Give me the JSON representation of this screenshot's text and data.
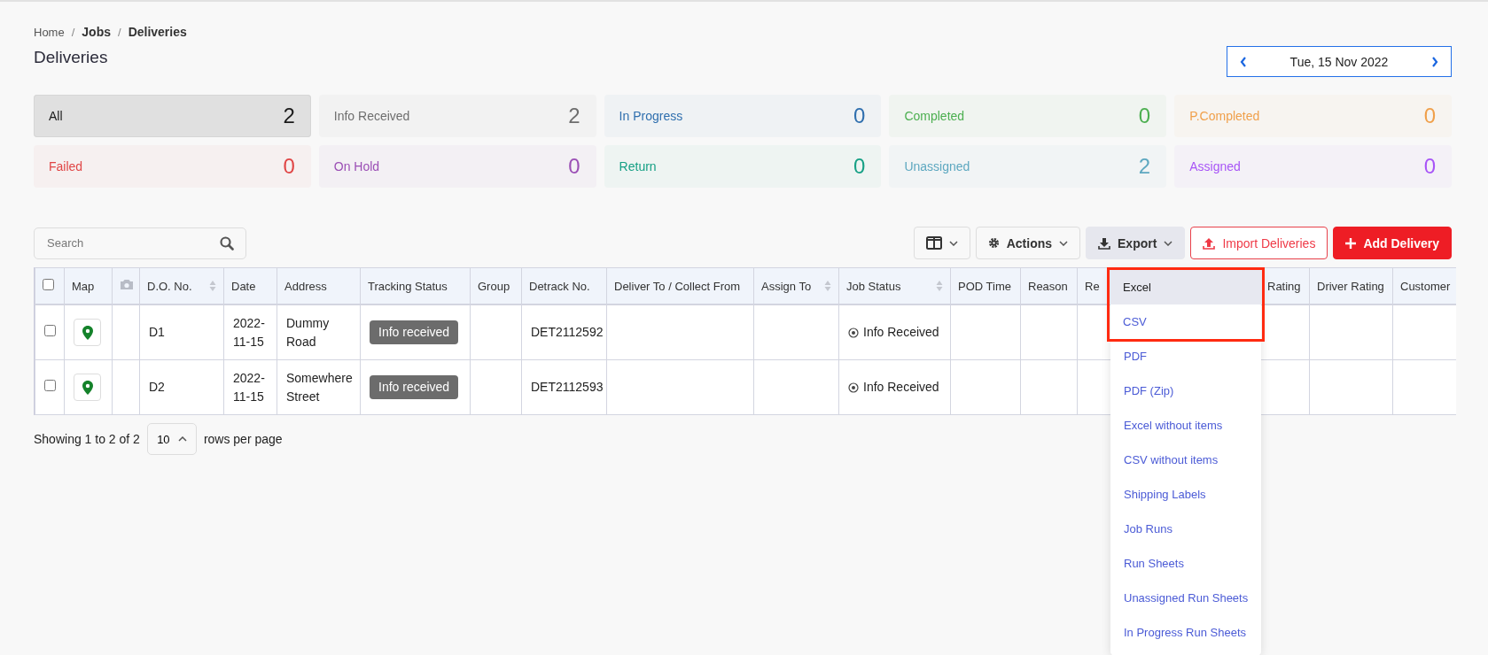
{
  "breadcrumb": {
    "separator": "/",
    "items": [
      {
        "label": "Home",
        "current": false
      },
      {
        "label": "Jobs",
        "current": true
      },
      {
        "label": "Deliveries",
        "current": true
      }
    ]
  },
  "page_title": "Deliveries",
  "date_picker": {
    "value": "Tue, 15 Nov 2022"
  },
  "status_cards": [
    {
      "label": "All",
      "count": "2",
      "color": "#1a1a1a",
      "selected": true
    },
    {
      "label": "Info Received",
      "count": "2",
      "color": "#6e6e6e",
      "selected": false
    },
    {
      "label": "In Progress",
      "count": "0",
      "color": "#2f6fae",
      "selected": false
    },
    {
      "label": "Completed",
      "count": "0",
      "color": "#4caf50",
      "selected": false
    },
    {
      "label": "P.Completed",
      "count": "0",
      "color": "#f0a04b",
      "selected": false
    },
    {
      "label": "Failed",
      "count": "0",
      "color": "#e04646",
      "selected": false
    },
    {
      "label": "On Hold",
      "count": "0",
      "color": "#9b4fb5",
      "selected": false
    },
    {
      "label": "Return",
      "count": "0",
      "color": "#16a085",
      "selected": false
    },
    {
      "label": "Unassigned",
      "count": "2",
      "color": "#5ea8c0",
      "selected": false
    },
    {
      "label": "Assigned",
      "count": "0",
      "color": "#a855f7",
      "selected": false
    }
  ],
  "search": {
    "placeholder": "Search"
  },
  "toolbar": {
    "actions_label": "Actions",
    "export": {
      "label": "Export",
      "expanded": true
    },
    "import_label": "Import Deliveries",
    "add_label": "Add Delivery"
  },
  "table": {
    "columns": [
      {
        "kind": "checkbox",
        "checked": false
      },
      {
        "kind": "text",
        "label": "Map",
        "sortable": false
      },
      {
        "kind": "camera"
      },
      {
        "kind": "text",
        "label": "D.O. No.",
        "sortable": true
      },
      {
        "kind": "text",
        "label": "Date",
        "sortable": false
      },
      {
        "kind": "text",
        "label": "Address",
        "sortable": false
      },
      {
        "kind": "text",
        "label": "Tracking Status",
        "sortable": false
      },
      {
        "kind": "text",
        "label": "Group",
        "sortable": false
      },
      {
        "kind": "text",
        "label": "Detrack No.",
        "sortable": false
      },
      {
        "kind": "text",
        "label": "Deliver To / Collect From",
        "sortable": false
      },
      {
        "kind": "text",
        "label": "Assign To",
        "sortable": true
      },
      {
        "kind": "text",
        "label": "Job Status",
        "sortable": true
      },
      {
        "kind": "text",
        "label": "POD Time",
        "sortable": false
      },
      {
        "kind": "text",
        "label": "Reason",
        "sortable": false
      },
      {
        "kind": "text",
        "label": "Re"
      },
      {
        "kind": "text",
        "label": "Rating"
      },
      {
        "kind": "text",
        "label": "Driver Rating"
      },
      {
        "kind": "text",
        "label": "Customer"
      }
    ],
    "rows": [
      {
        "selected": false,
        "do_no": "D1",
        "date": "2022-11-15",
        "address": "Dummy Road",
        "tracking_status": "Info received",
        "detrack_no": "DET2112592",
        "job_status": "Info Received"
      },
      {
        "selected": false,
        "do_no": "D2",
        "date": "2022-11-15",
        "address": "Somewhere Street",
        "tracking_status": "Info received",
        "detrack_no": "DET2112593",
        "job_status": "Info Received"
      }
    ]
  },
  "pagination": {
    "summary": "Showing 1 to 2 of 2",
    "page_size": "10",
    "suffix": "rows per page"
  },
  "export_menu": [
    {
      "label": "Excel",
      "selected": true,
      "annotated": true
    },
    {
      "label": "CSV",
      "selected": false,
      "annotated": true
    },
    {
      "label": "PDF",
      "selected": false,
      "annotated": false
    },
    {
      "label": "PDF (Zip)",
      "selected": false,
      "annotated": false
    },
    {
      "label": "Excel without items",
      "selected": false,
      "annotated": false
    },
    {
      "label": "CSV without items",
      "selected": false,
      "annotated": false
    },
    {
      "label": "Shipping Labels",
      "selected": false,
      "annotated": false
    },
    {
      "label": "Job Runs",
      "selected": false,
      "annotated": false
    },
    {
      "label": "Run Sheets",
      "selected": false,
      "annotated": false
    },
    {
      "label": "Unassigned Run Sheets",
      "selected": false,
      "annotated": false
    },
    {
      "label": "In Progress Run Sheets",
      "selected": false,
      "annotated": false
    }
  ]
}
